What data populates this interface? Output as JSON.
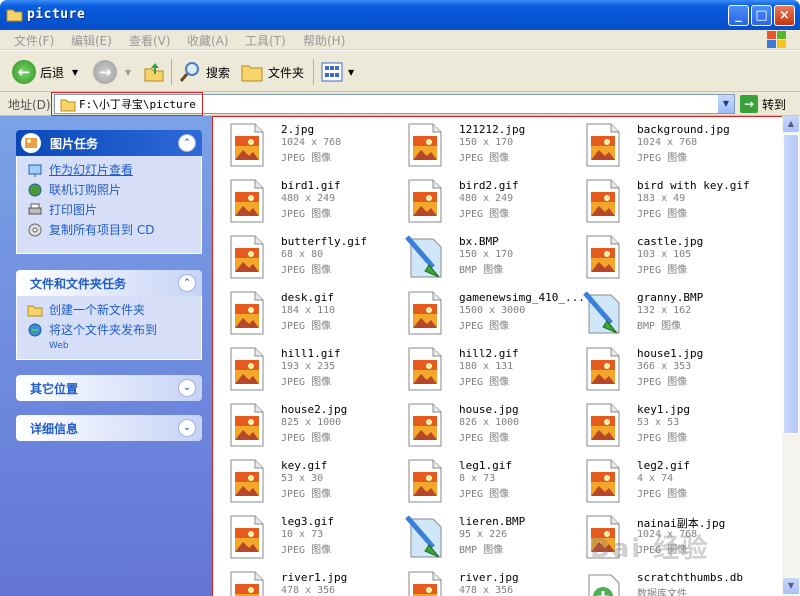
{
  "window": {
    "title": "picture",
    "min": "_",
    "max": "□",
    "close": "×"
  },
  "menu": [
    "文件(F)",
    "编辑(E)",
    "查看(V)",
    "收藏(A)",
    "工具(T)",
    "帮助(H)"
  ],
  "toolbar": {
    "back": "后退",
    "search": "搜索",
    "folders": "文件夹"
  },
  "address": {
    "label": "地址(D)",
    "value": "F:\\小丁寻宝\\picture",
    "go": "转到"
  },
  "sidebar": {
    "picture_tasks": {
      "title": "图片任务",
      "items": [
        "作为幻灯片查看",
        "联机订购照片",
        "打印图片",
        "复制所有项目到 CD"
      ]
    },
    "file_tasks": {
      "title": "文件和文件夹任务",
      "items": [
        "创建一个新文件夹",
        "将这个文件夹发布到"
      ],
      "sub": "Web"
    },
    "other": {
      "title": "其它位置"
    },
    "details": {
      "title": "详细信息"
    }
  },
  "files": [
    {
      "name": "2.jpg",
      "dims": "1024 x 768",
      "type": "JPEG 图像",
      "icon": "image"
    },
    {
      "name": "121212.jpg",
      "dims": "150 x 170",
      "type": "JPEG 图像",
      "icon": "image"
    },
    {
      "name": "background.jpg",
      "dims": "1024 x 768",
      "type": "JPEG 图像",
      "icon": "image"
    },
    {
      "name": "bird1.gif",
      "dims": "480 x 249",
      "type": "JPEG 图像",
      "icon": "image"
    },
    {
      "name": "bird2.gif",
      "dims": "480 x 249",
      "type": "JPEG 图像",
      "icon": "image"
    },
    {
      "name": "bird with key.gif",
      "dims": "183 x 49",
      "type": "JPEG 图像",
      "icon": "image"
    },
    {
      "name": "butterfly.gif",
      "dims": "68 x 80",
      "type": "JPEG 图像",
      "icon": "image"
    },
    {
      "name": "bx.BMP",
      "dims": "150 x 170",
      "type": "BMP 图像",
      "icon": "bmp"
    },
    {
      "name": "castle.jpg",
      "dims": "103 x 105",
      "type": "JPEG 图像",
      "icon": "image"
    },
    {
      "name": "desk.gif",
      "dims": "184 x 110",
      "type": "JPEG 图像",
      "icon": "image"
    },
    {
      "name": "gamenewsimg_410_...",
      "dims": "1500 x 3000",
      "type": "JPEG 图像",
      "icon": "image"
    },
    {
      "name": "granny.BMP",
      "dims": "132 x 162",
      "type": "BMP 图像",
      "icon": "bmp"
    },
    {
      "name": "hill1.gif",
      "dims": "193 x 235",
      "type": "JPEG 图像",
      "icon": "image"
    },
    {
      "name": "hill2.gif",
      "dims": "180 x 131",
      "type": "JPEG 图像",
      "icon": "image"
    },
    {
      "name": "house1.jpg",
      "dims": "366 x 353",
      "type": "JPEG 图像",
      "icon": "image"
    },
    {
      "name": "house2.jpg",
      "dims": "825 x 1000",
      "type": "JPEG 图像",
      "icon": "image"
    },
    {
      "name": "house.jpg",
      "dims": "826 x 1000",
      "type": "JPEG 图像",
      "icon": "image"
    },
    {
      "name": "key1.jpg",
      "dims": "53 x 53",
      "type": "JPEG 图像",
      "icon": "image"
    },
    {
      "name": "key.gif",
      "dims": "53 x 30",
      "type": "JPEG 图像",
      "icon": "image"
    },
    {
      "name": "leg1.gif",
      "dims": "8 x 73",
      "type": "JPEG 图像",
      "icon": "image"
    },
    {
      "name": "leg2.gif",
      "dims": "4 x 74",
      "type": "JPEG 图像",
      "icon": "image"
    },
    {
      "name": "leg3.gif",
      "dims": "10 x 73",
      "type": "JPEG 图像",
      "icon": "image"
    },
    {
      "name": "lieren.BMP",
      "dims": "95 x 226",
      "type": "BMP 图像",
      "icon": "bmp"
    },
    {
      "name": "nainai副本.jpg",
      "dims": "1024 x 768",
      "type": "JPEG 图像",
      "icon": "image"
    },
    {
      "name": "river1.jpg",
      "dims": "478 x 356",
      "type": "",
      "icon": "image"
    },
    {
      "name": "river.jpg",
      "dims": "478 x 356",
      "type": "",
      "icon": "image"
    },
    {
      "name": "scratchthumbs.db",
      "dims": "数据库文件",
      "type": "",
      "icon": "db"
    }
  ],
  "watermark": "Bai 经验"
}
